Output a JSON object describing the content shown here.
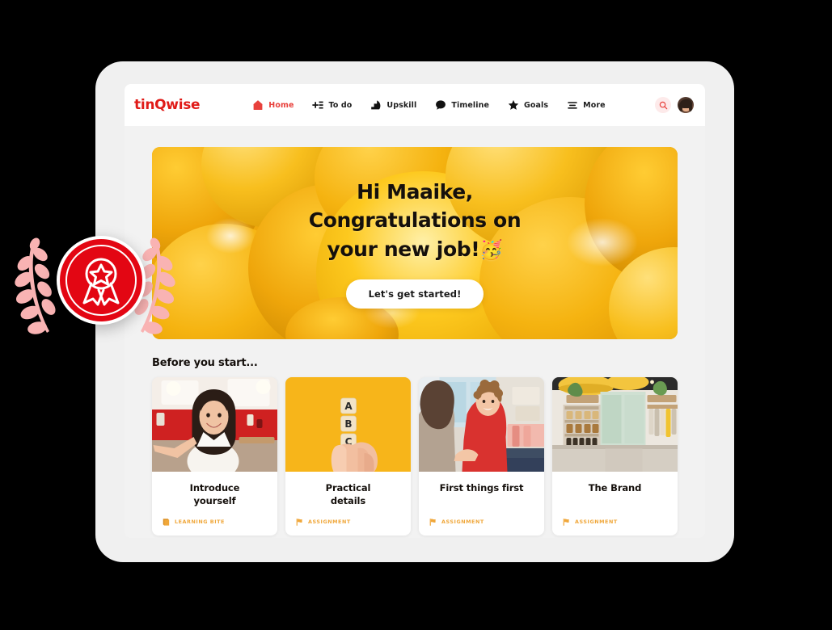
{
  "brand": {
    "name": "tinQwise"
  },
  "nav": {
    "items": [
      {
        "label": "Home",
        "icon": "home-icon",
        "active": true
      },
      {
        "label": "To do",
        "icon": "todo-icon",
        "active": false
      },
      {
        "label": "Upskill",
        "icon": "upskill-icon",
        "active": false
      },
      {
        "label": "Timeline",
        "icon": "timeline-icon",
        "active": false
      },
      {
        "label": "Goals",
        "icon": "goals-icon",
        "active": false
      },
      {
        "label": "More",
        "icon": "more-icon",
        "active": false
      }
    ],
    "search_icon": "search-icon",
    "avatar_alt": "user-avatar"
  },
  "hero": {
    "greeting": "Hi Maaike,",
    "line2": "Congratulations on",
    "line3": "your new job!",
    "emoji": "🥳",
    "cta_label": "Let's get started!",
    "background_color": "#f5b310"
  },
  "section": {
    "heading": "Before you start..."
  },
  "cards": [
    {
      "title_line1": "Introduce",
      "title_line2": "yourself",
      "tag": "LEARNING BITE",
      "tag_icon": "learning-bite-icon"
    },
    {
      "title_line1": "Practical",
      "title_line2": "details",
      "tag": "ASSIGNMENT",
      "tag_icon": "flag-icon"
    },
    {
      "title_line1": "First things first",
      "title_line2": "",
      "tag": "ASSIGNMENT",
      "tag_icon": "flag-icon"
    },
    {
      "title_line1": "The Brand",
      "title_line2": "",
      "tag": "ASSIGNMENT",
      "tag_icon": "flag-icon"
    }
  ],
  "ornament": {
    "badge_icon": "award-ribbon-icon",
    "laurel_icon": "laurel-branch-icon",
    "badge_color": "#e30613",
    "laurel_color": "#f9b3b3"
  },
  "colors": {
    "brand_red": "#e01b18",
    "accent_orange": "#f0a73a",
    "hero_yellow": "#f5b310",
    "device_gray": "#f0f0f0",
    "page_gray": "#f2f2f2"
  }
}
